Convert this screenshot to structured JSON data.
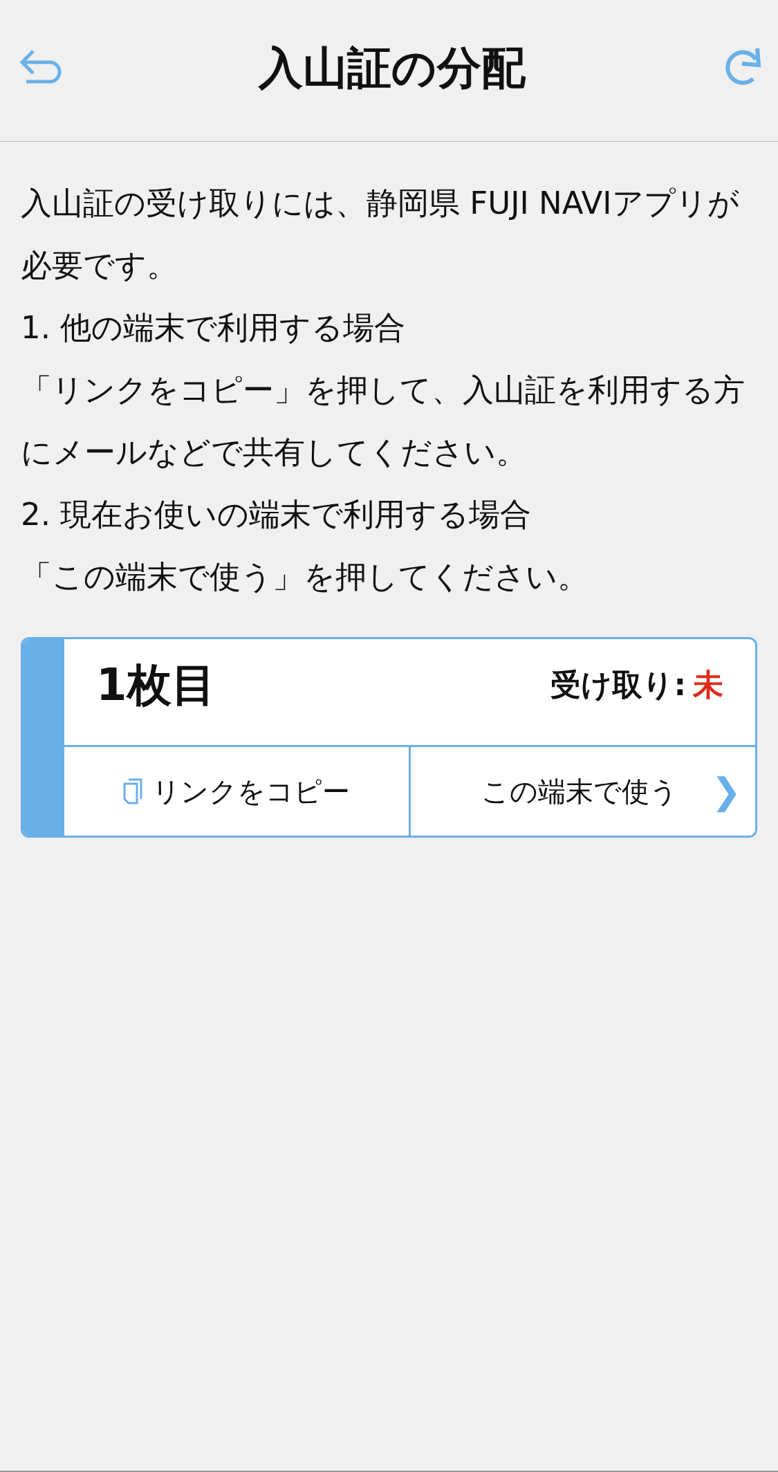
{
  "header": {
    "title": "入山証の分配"
  },
  "instructions": [
    "入山証の受け取りには、静岡県 FUJI NAVIアプリが必要です。",
    "1. 他の端末で利用する場合",
    "「リンクをコピー」を押して、入山証を利用する方にメールなどで共有してください。",
    "2. 現在お使いの端末で利用する場合",
    "「この端末で使う」を押してください。"
  ],
  "tickets": [
    {
      "title": "1枚目",
      "status_label": "受け取り:",
      "status": "未",
      "copy_button": "リンクをコピー",
      "use_button": "この端末で使う",
      "chevron": "❯"
    }
  ]
}
